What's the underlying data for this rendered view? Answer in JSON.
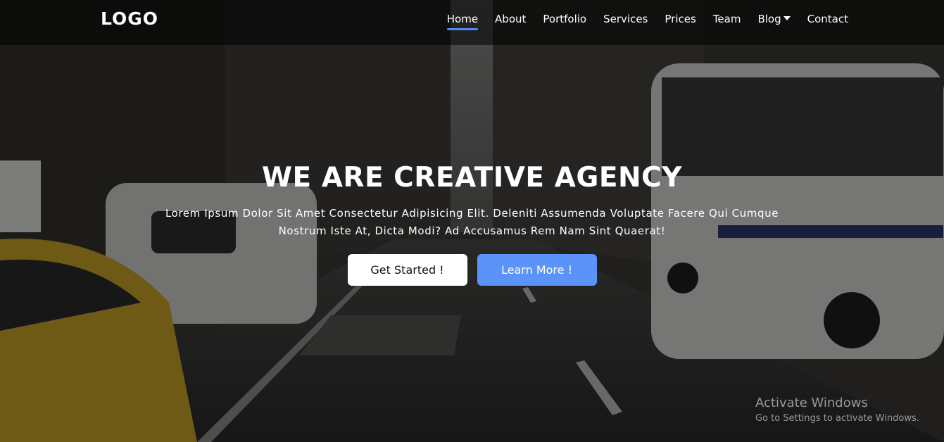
{
  "brand": {
    "logo_text": "LOGO"
  },
  "nav": {
    "items": [
      {
        "label": "Home",
        "active": true
      },
      {
        "label": "About"
      },
      {
        "label": "Portfolio"
      },
      {
        "label": "Services"
      },
      {
        "label": "Prices"
      },
      {
        "label": "Team"
      },
      {
        "label": "Blog",
        "has_dropdown": true
      },
      {
        "label": "Contact"
      }
    ],
    "active_underline_color": "#4f8bf5"
  },
  "hero": {
    "title": "WE ARE CREATIVE AGENCY",
    "subtitle": "Lorem Ipsum Dolor Sit Amet Consectetur Adipisicing Elit. Deleniti Assumenda Voluptate Facere Qui Cumque Nostrum Iste At, Dicta Modi? Ad Accusamus Rem Nam Sint Quaerat!",
    "primary_button": "Get Started !",
    "secondary_button": "Learn More !",
    "secondary_button_color": "#5b93f8"
  },
  "watermark": {
    "title": "Activate Windows",
    "subtitle": "Go to Settings to activate Windows."
  }
}
